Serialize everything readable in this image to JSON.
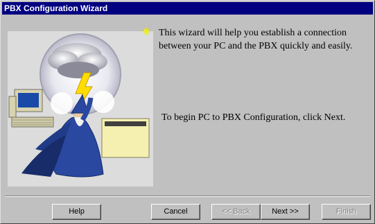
{
  "window": {
    "title": "PBX Configuration Wizard"
  },
  "content": {
    "intro": "This wizard will help you establish a connection between your PC and the PBX quickly and easily.",
    "instruction": "To begin PC to PBX Configuration, click Next."
  },
  "buttons": {
    "help": "Help",
    "cancel": "Cancel",
    "back": "<< Back",
    "next": "Next >>",
    "finish": "Finish"
  },
  "states": {
    "back_enabled": false,
    "finish_enabled": false
  },
  "icons": [
    "wizard-illustration",
    "star-bullet-icon"
  ],
  "colors": {
    "titlebar": "#000080",
    "face": "#c0c0c0"
  }
}
